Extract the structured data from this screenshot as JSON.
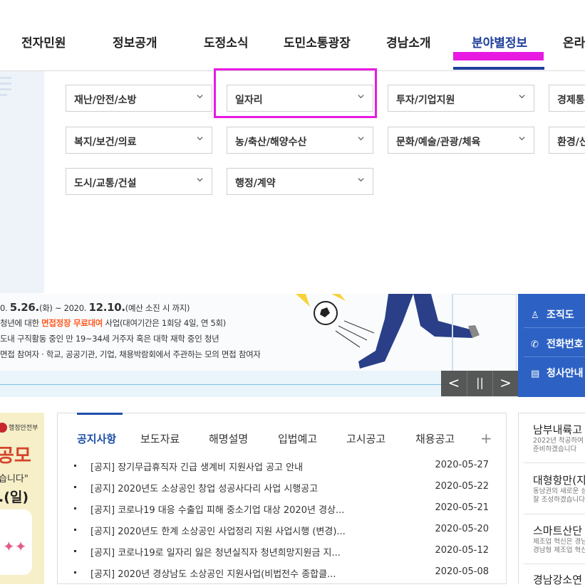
{
  "nav": {
    "items": [
      "전자민원",
      "정보공개",
      "도정소식",
      "도민소통광장",
      "경남소개",
      "분야별정보",
      "온라"
    ],
    "active_index": 5
  },
  "menu": {
    "categories": [
      "재난/안전/소방",
      "일자리",
      "투자/기업지원",
      "경제통",
      "복지/보건/의료",
      "농/축산/해양수산",
      "문화/예술/관광/체육",
      "환경/신",
      "도시/교통/건설",
      "행정/계약"
    ],
    "highlighted": "일자리"
  },
  "banner": {
    "line1_prefix": "0. ",
    "line1_d1": "5.26.",
    "line1_d1_day": "(화) ~ 2020. ",
    "line1_d2": "12.10.",
    "line1_suffix": "(예산 소진 시 까지)",
    "line2_a": "청년에 대한 ",
    "line2_hl": "면접정장 무료대여",
    "line2_b": " 사업(대여기간은 1회당 4일, 연 5회)",
    "line3": "도내 구직활동 중인 만 19~34세 거주자 혹은 대학 재학 중인 청년",
    "line4": "면접 참여자 · 학교, 공공기관, 기업, 채용박람회에서 주관하는 모의 면접 참여자",
    "controls": {
      "prev": "<",
      "pause": "||",
      "next": ">"
    }
  },
  "quicklinks": [
    {
      "label": "조직도",
      "icon": "organization-icon"
    },
    {
      "label": "전화번호",
      "icon": "phone-icon"
    },
    {
      "label": "청사안내",
      "icon": "building-guide-icon"
    }
  ],
  "promo": {
    "ministry": "행정안전부",
    "title": "공모",
    "quote": "습니다\"",
    "date": ".(일)"
  },
  "board": {
    "tabs": [
      "공지사항",
      "보도자료",
      "해명설명",
      "입법예고",
      "고시공고",
      "채용공고"
    ],
    "active_tab": 0,
    "more": "+",
    "rows": [
      {
        "title": "[공지] 장기무급휴직자 긴급 생계비 지원사업 공고 안내",
        "date": "2020-05-27"
      },
      {
        "title": "[공지] 2020년도 소상공인 창업 성공사다리 사업 시행공고",
        "date": "2020-05-22"
      },
      {
        "title": "[공지] 코로나19 대응 수출입 피해 중소기업 대상 2020년 경상...",
        "date": "2020-05-21"
      },
      {
        "title": "[공지] 2020년도 한계 소상공인 사업정리 지원 사업시행 (변경)...",
        "date": "2020-05-20"
      },
      {
        "title": "[공지] 코로나19로 일자리 잃은 청년실직자 청년희망지원금 지...",
        "date": "2020-05-12"
      },
      {
        "title": "[공지] 2020년 경상남도 소상공인 지원사업(비법전수 종합클...",
        "date": "2020-05-08"
      }
    ]
  },
  "sidenews": [
    {
      "headline": "남부내륙고",
      "desc1": "2022년 착공하여",
      "desc2": "준비하겠습니다"
    },
    {
      "headline": "대형항만(지",
      "desc1": "동남권의 새로운 성",
      "desc2": "잘 조성하겠습니다"
    },
    {
      "headline": "스마트산단",
      "desc1": "제조업 혁신은 경남",
      "desc2": "경남형 제조업 혁신"
    },
    {
      "headline": "경남강소연",
      "desc1": "",
      "desc2": ""
    }
  ],
  "colors": {
    "brand_blue": "#1f3f9a",
    "quick_blue": "#2d62c4",
    "annotation_magenta": "#e81ae2",
    "highlight_orange": "#ff5a1f"
  }
}
